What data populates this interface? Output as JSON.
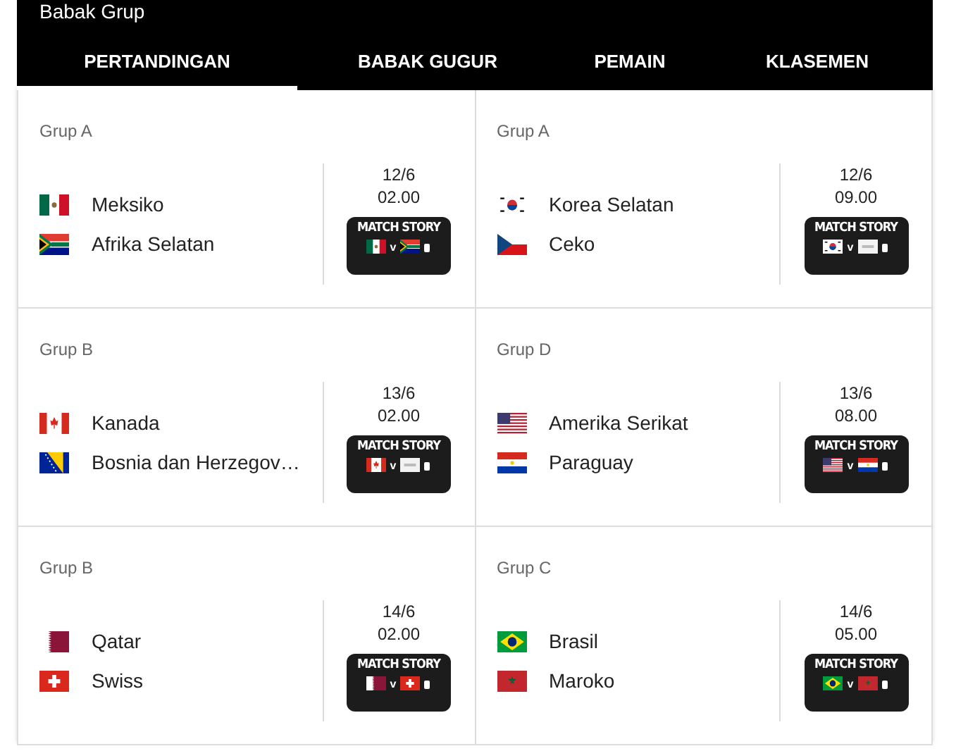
{
  "header": {
    "title": "Babak Grup"
  },
  "tabs": [
    {
      "label": "PERTANDINGAN",
      "selected": true
    },
    {
      "label": "BABAK GUGUR",
      "selected": false
    },
    {
      "label": "PEMAIN",
      "selected": false
    },
    {
      "label": "KLASEMEN",
      "selected": false
    }
  ],
  "matches": [
    {
      "group": "Grup A",
      "teams": [
        {
          "name": "Meksiko",
          "kind": "mx"
        },
        {
          "name": "Afrika Selatan",
          "kind": "za"
        }
      ],
      "date": "12/6",
      "time": "02.00",
      "badge": {
        "title": "MATCH STORY",
        "vs": "v",
        "flag_kinds": [
          {
            "kind": "mx"
          },
          {
            "kind": "za"
          }
        ]
      }
    },
    {
      "group": "Grup A",
      "teams": [
        {
          "name": "Korea Selatan",
          "kind": "kr"
        },
        {
          "name": "Ceko",
          "kind": "cz"
        }
      ],
      "date": "12/6",
      "time": "09.00",
      "badge": {
        "title": "MATCH STORY",
        "vs": "v",
        "flag_kinds": [
          {
            "kind": "kr"
          },
          {
            "kind": "blank"
          }
        ]
      }
    },
    {
      "group": "Grup B",
      "teams": [
        {
          "name": "Kanada",
          "kind": "ca"
        },
        {
          "name": "Bosnia dan Herzegov…",
          "kind": "ba"
        }
      ],
      "date": "13/6",
      "time": "02.00",
      "badge": {
        "title": "MATCH STORY",
        "vs": "v",
        "flag_kinds": [
          {
            "kind": "ca"
          },
          {
            "kind": "blank"
          }
        ]
      }
    },
    {
      "group": "Grup D",
      "teams": [
        {
          "name": "Amerika Serikat",
          "kind": "us"
        },
        {
          "name": "Paraguay",
          "kind": "py"
        }
      ],
      "date": "13/6",
      "time": "08.00",
      "badge": {
        "title": "MATCH STORY",
        "vs": "v",
        "flag_kinds": [
          {
            "kind": "us"
          },
          {
            "kind": "py"
          }
        ]
      }
    },
    {
      "group": "Grup B",
      "teams": [
        {
          "name": "Qatar",
          "kind": "qa"
        },
        {
          "name": "Swiss",
          "kind": "ch"
        }
      ],
      "date": "14/6",
      "time": "02.00",
      "badge": {
        "title": "MATCH STORY",
        "vs": "v",
        "flag_kinds": [
          {
            "kind": "qa"
          },
          {
            "kind": "ch"
          }
        ]
      }
    },
    {
      "group": "Grup C",
      "teams": [
        {
          "name": "Brasil",
          "kind": "br"
        },
        {
          "name": "Maroko",
          "kind": "ma"
        }
      ],
      "date": "14/6",
      "time": "05.00",
      "badge": {
        "title": "MATCH STORY",
        "vs": "v",
        "flag_kinds": [
          {
            "kind": "br"
          },
          {
            "kind": "ma"
          }
        ]
      }
    }
  ]
}
